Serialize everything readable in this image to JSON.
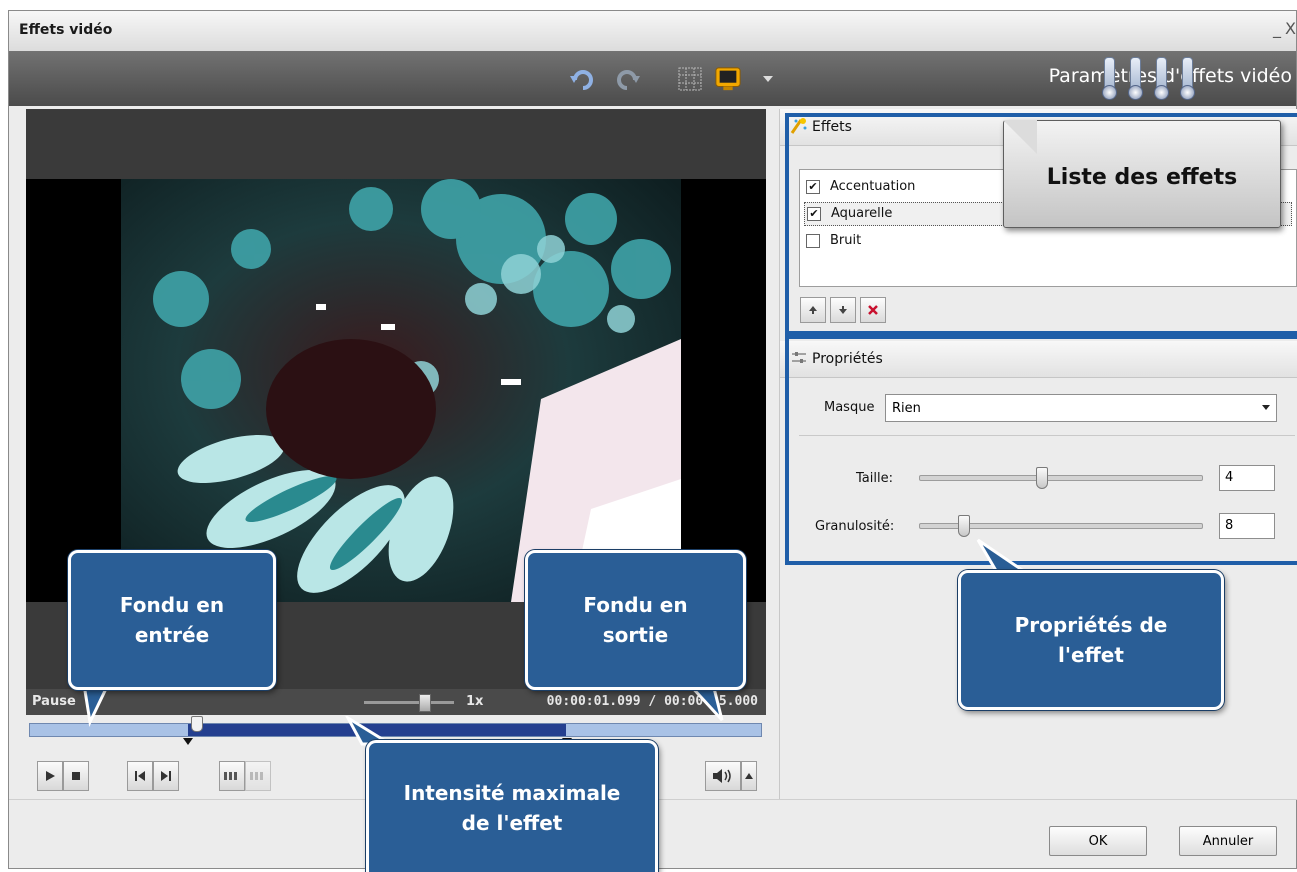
{
  "window": {
    "title": "Effets vidéo",
    "controls": {
      "minimize": "_",
      "close": "X"
    }
  },
  "toolbar": {
    "icons": [
      "undo-icon",
      "redo-icon",
      "grid-icon",
      "monitor-icon",
      "dropdown-arrow-icon"
    ],
    "label": "Paramètres d'effets vidéo"
  },
  "player": {
    "status": "Pause",
    "speed": "1x",
    "time": "00:00:01.099 / 00:00:05.000",
    "volume_icon": "speaker-icon"
  },
  "effects_panel": {
    "header": "Effets",
    "items": [
      {
        "label": "Accentuation",
        "checked": true,
        "selected": false
      },
      {
        "label": "Aquarelle",
        "checked": true,
        "selected": true
      },
      {
        "label": "Bruit",
        "checked": false,
        "selected": false
      }
    ],
    "check_mark": "✔",
    "buttons": [
      "move-up-icon",
      "move-down-icon",
      "delete-icon"
    ]
  },
  "properties_panel": {
    "header": "Propriétés",
    "mask_label": "Masque",
    "mask_value": "Rien",
    "size_label": "Taille:",
    "size_value": "4",
    "grain_label": "Granulosité:",
    "grain_value": "8"
  },
  "dialog_buttons": {
    "ok": "OK",
    "cancel": "Annuler"
  },
  "callouts": {
    "fade_in": "Fondu en\nentrée",
    "fade_out": "Fondu en\nsortie",
    "max_intensity": "Intensité maximale\nde l'effet",
    "effect_properties": "Propriétés de\nl'effet",
    "effects_list": "Liste des effets"
  },
  "colors": {
    "callout_blue": "#2a5e96",
    "highlight_blue": "#1f5ea8",
    "timeline_light": "#a9c2e6",
    "timeline_dark": "#243f8f"
  }
}
